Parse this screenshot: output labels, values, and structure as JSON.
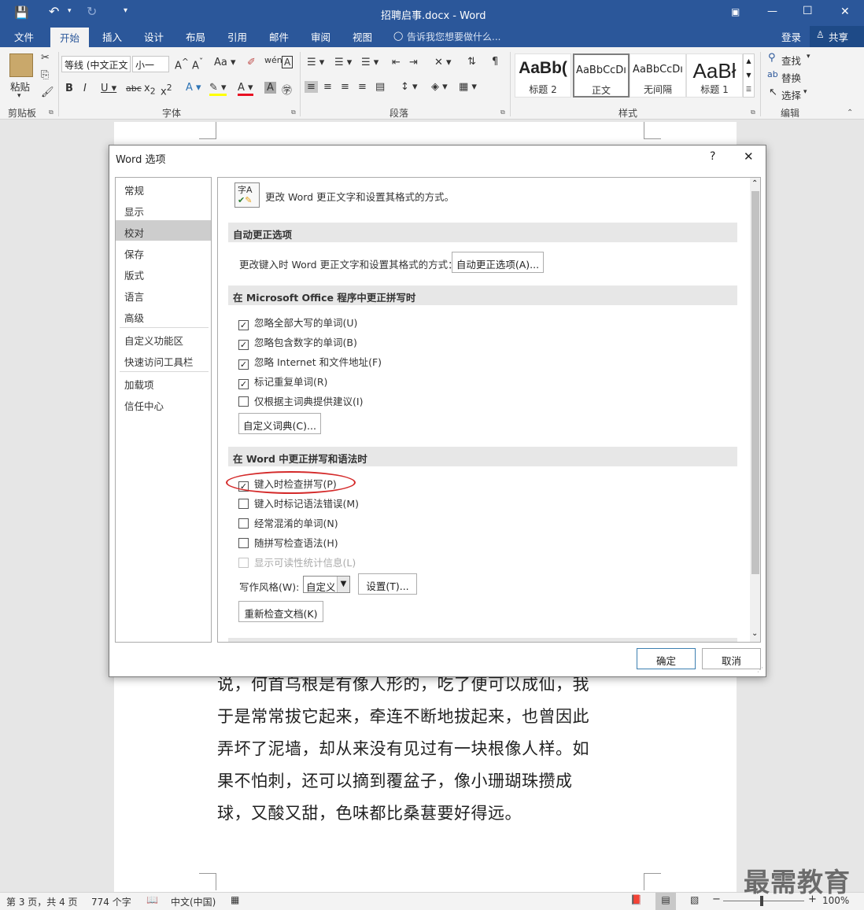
{
  "titlebar": {
    "save_icon": "save-icon",
    "undo_icon": "undo-icon",
    "redo_icon": "redo-icon",
    "customize_icon": "customize-qat-icon",
    "title": "招聘启事.docx - Word",
    "minimize": "—",
    "maximize": "☐",
    "close": "✕"
  },
  "tabs": [
    {
      "label": "文件"
    },
    {
      "label": "开始"
    },
    {
      "label": "插入"
    },
    {
      "label": "设计"
    },
    {
      "label": "布局"
    },
    {
      "label": "引用"
    },
    {
      "label": "邮件"
    },
    {
      "label": "审阅"
    },
    {
      "label": "视图"
    }
  ],
  "tellme": "告诉我您想要做什么...",
  "login": "登录",
  "share": "共享",
  "ribbon": {
    "paste": "粘贴",
    "font_name": "等线 (中文正文",
    "font_size": "小一",
    "styles": [
      {
        "preview": "AaBb(",
        "label": "标题 2"
      },
      {
        "preview": "AaBbCcDı",
        "label": "正文"
      },
      {
        "preview": "AaBbCcDı",
        "label": "无间隔"
      },
      {
        "preview": "AaBł",
        "label": "标题 1"
      }
    ],
    "find": "查找",
    "replace": "替换",
    "select": "选择",
    "groups": {
      "clipboard": "剪贴板",
      "font": "字体",
      "paragraph": "段落",
      "styles": "样式",
      "editing": "编辑"
    }
  },
  "document": {
    "lines": [
      "说，何首乌根是有像人形的，吃了便可以成仙，我",
      "于是常常拔它起来，牵连不断地拔起来，也曾因此",
      "弄坏了泥墙，却从来没有见过有一块根像人样。如",
      "果不怕刺，还可以摘到覆盆子，像小珊瑚珠攒成",
      "球，又酸又甜，色味都比桑葚要好得远。"
    ]
  },
  "status": {
    "page": "第 3 页，共 4 页",
    "words": "774 个字",
    "language": "中文(中国)",
    "zoom": "100%",
    "watermark": "最需教育"
  },
  "dialog": {
    "title": "Word 选项",
    "help": "?",
    "close": "✕",
    "nav": [
      "常规",
      "显示",
      "校对",
      "保存",
      "版式",
      "语言",
      "高级",
      "自定义功能区",
      "快速访问工具栏",
      "加载项",
      "信任中心"
    ],
    "header_text": "更改 Word 更正文字和设置其格式的方式。",
    "sections": {
      "autocorrect": "自动更正选项",
      "office_spelling": "在 Microsoft Office 程序中更正拼写时",
      "word_spelling": "在 Word 中更正拼写和语法时"
    },
    "autocorrect_desc": "更改键入时 Word 更正文字和设置其格式的方式：",
    "autocorrect_btn": "自动更正选项(A)...",
    "office_checks": [
      {
        "label": "忽略全部大写的单词(U)",
        "checked": true
      },
      {
        "label": "忽略包含数字的单词(B)",
        "checked": true
      },
      {
        "label": "忽略 Internet 和文件地址(F)",
        "checked": true
      },
      {
        "label": "标记重复单词(R)",
        "checked": true
      },
      {
        "label": "仅根据主词典提供建议(I)",
        "checked": false
      }
    ],
    "custom_dict_btn": "自定义词典(C)...",
    "word_checks": [
      {
        "label": "键入时检查拼写(P)",
        "checked": true
      },
      {
        "label": "键入时标记语法错误(M)",
        "checked": false
      },
      {
        "label": "经常混淆的单词(N)",
        "checked": false
      },
      {
        "label": "随拼写检查语法(H)",
        "checked": false
      },
      {
        "label": "显示可读性统计信息(L)",
        "checked": false,
        "disabled": true
      }
    ],
    "writing_style_label": "写作风格(W):",
    "writing_style_value": "自定义",
    "settings_btn": "设置(T)...",
    "recheck_btn": "重新检查文档(K)",
    "ok": "确定",
    "cancel": "取消",
    "highlight_color": "#d42a2a"
  }
}
